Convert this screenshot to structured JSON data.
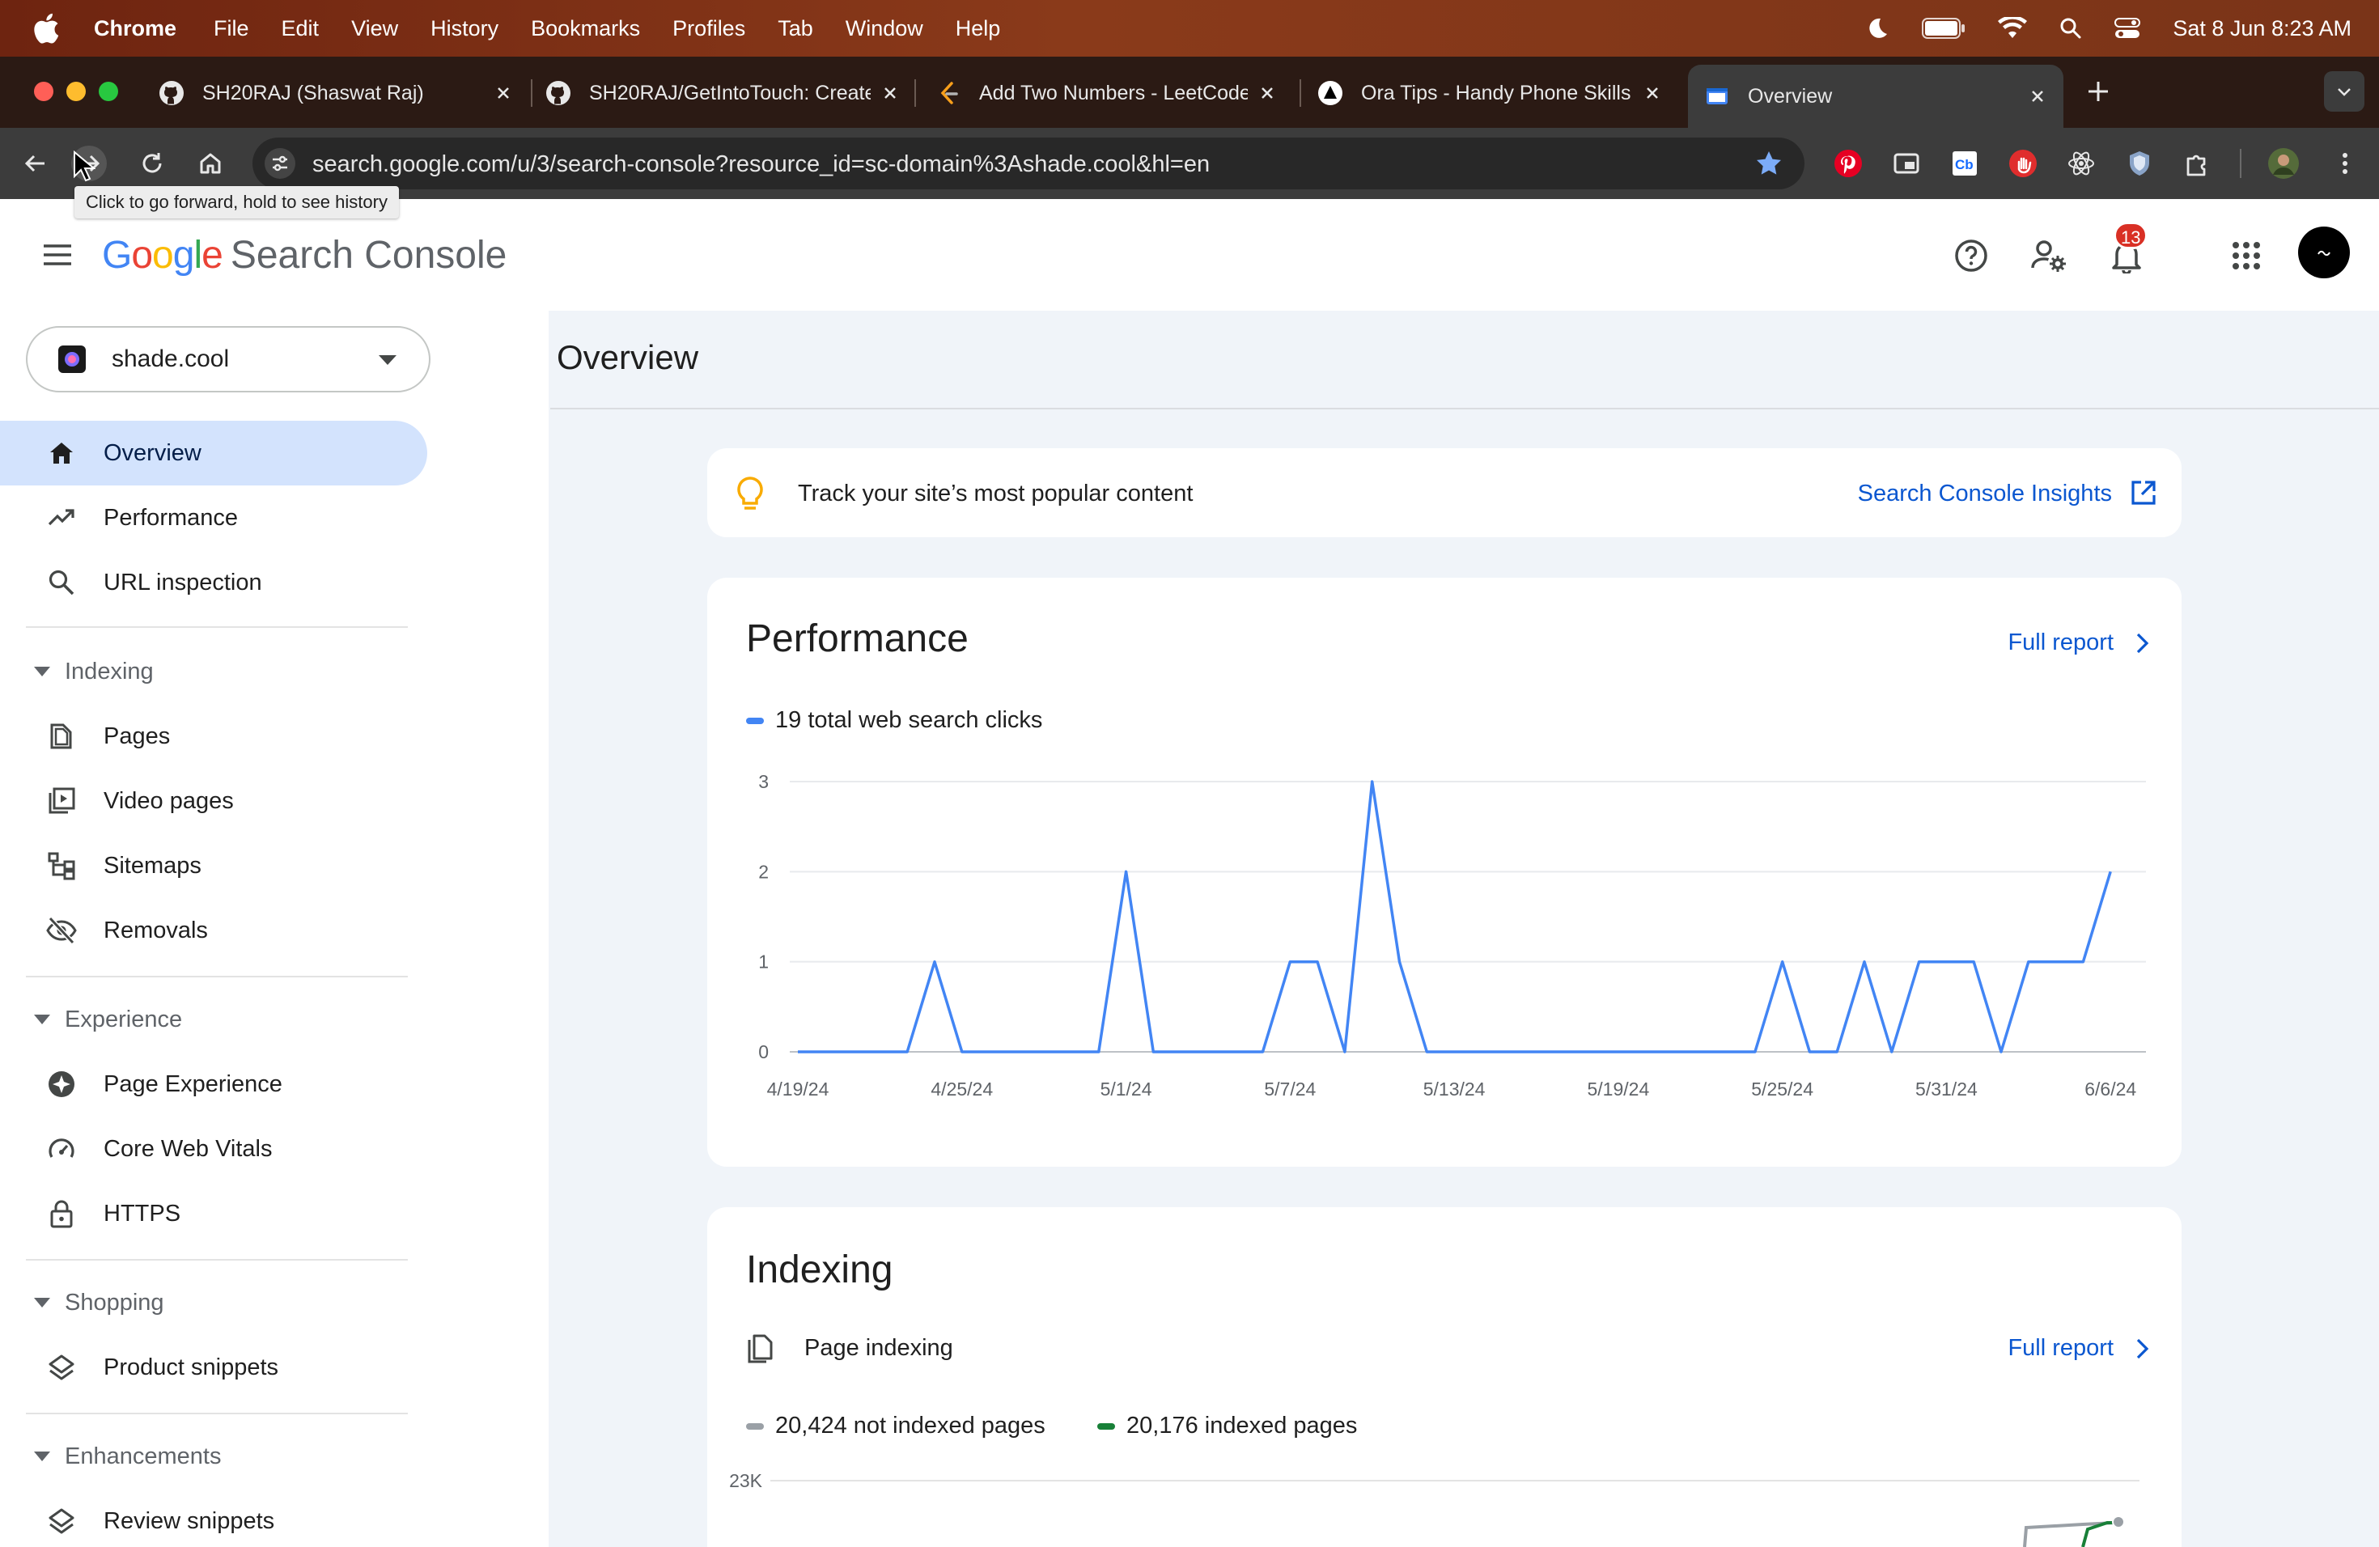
{
  "menubar": {
    "app_name": "Chrome",
    "items": [
      "File",
      "Edit",
      "View",
      "History",
      "Bookmarks",
      "Profiles",
      "Tab",
      "Window",
      "Help"
    ],
    "clock": "Sat 8 Jun  8:23 AM"
  },
  "tabs": [
    {
      "title": "SH20RAJ (Shaswat Raj)",
      "icon": "github-icon"
    },
    {
      "title": "SH20RAJ/GetIntoTouch: Create",
      "icon": "github-icon"
    },
    {
      "title": "Add Two Numbers - LeetCode",
      "icon": "leetcode-icon"
    },
    {
      "title": "Ora Tips - Handy Phone Skills",
      "icon": "ora-icon"
    },
    {
      "title": "Overview",
      "icon": "search-console-icon",
      "active": true
    }
  ],
  "toolbar": {
    "url": "search.google.com/u/3/search-console?resource_id=sc-domain%3Ashade.cool&hl=en",
    "forward_tooltip": "Click to go forward, hold to see history"
  },
  "header": {
    "logo_google": "Google",
    "logo_product": "Search Console",
    "notification_count": "13"
  },
  "sidebar": {
    "property": "shade.cool",
    "items": [
      {
        "label": "Overview",
        "icon": "home-icon",
        "selected": true
      },
      {
        "label": "Performance",
        "icon": "trending-up-icon"
      },
      {
        "label": "URL inspection",
        "icon": "search-icon"
      }
    ],
    "sections": [
      {
        "label": "Indexing",
        "items": [
          {
            "label": "Pages",
            "icon": "pages-icon"
          },
          {
            "label": "Video pages",
            "icon": "video-pages-icon"
          },
          {
            "label": "Sitemaps",
            "icon": "sitemap-icon"
          },
          {
            "label": "Removals",
            "icon": "eye-off-icon"
          }
        ]
      },
      {
        "label": "Experience",
        "items": [
          {
            "label": "Page Experience",
            "icon": "page-experience-icon"
          },
          {
            "label": "Core Web Vitals",
            "icon": "gauge-icon"
          },
          {
            "label": "HTTPS",
            "icon": "lock-icon"
          }
        ]
      },
      {
        "label": "Shopping",
        "items": [
          {
            "label": "Product snippets",
            "icon": "layers-icon"
          }
        ]
      },
      {
        "label": "Enhancements",
        "items": [
          {
            "label": "Review snippets",
            "icon": "layers-icon"
          }
        ]
      }
    ]
  },
  "main": {
    "title": "Overview",
    "insight": {
      "text": "Track your site’s most popular content",
      "link": "Search Console Insights"
    },
    "performance": {
      "title": "Performance",
      "full_report": "Full report",
      "legend": "19 total web search clicks"
    },
    "indexing": {
      "title": "Indexing",
      "subtitle": "Page indexing",
      "full_report": "Full report",
      "legend_not_indexed": "20,424 not indexed pages",
      "legend_indexed": "20,176 indexed pages",
      "y_top_label": "23K"
    }
  },
  "colors": {
    "accent_blue": "#0b57d0",
    "series_blue": "#4285f4",
    "indexed_green": "#188038",
    "not_indexed_gray": "#9aa0a6",
    "selected_nav": "#d3e3fd"
  },
  "chart_data": [
    {
      "type": "line",
      "x": [
        "4/19/24",
        "4/20/24",
        "4/21/24",
        "4/22/24",
        "4/23/24",
        "4/24/24",
        "4/25/24",
        "4/26/24",
        "4/27/24",
        "4/28/24",
        "4/29/24",
        "4/30/24",
        "5/1/24",
        "5/2/24",
        "5/3/24",
        "5/4/24",
        "5/5/24",
        "5/6/24",
        "5/7/24",
        "5/8/24",
        "5/9/24",
        "5/10/24",
        "5/11/24",
        "5/12/24",
        "5/13/24",
        "5/14/24",
        "5/15/24",
        "5/16/24",
        "5/17/24",
        "5/18/24",
        "5/19/24",
        "5/20/24",
        "5/21/24",
        "5/22/24",
        "5/23/24",
        "5/24/24",
        "5/25/24",
        "5/26/24",
        "5/27/24",
        "5/28/24",
        "5/29/24",
        "5/30/24",
        "5/31/24",
        "6/1/24",
        "6/2/24",
        "6/3/24",
        "6/4/24",
        "6/5/24",
        "6/6/24",
        "6/7/24"
      ],
      "xticks": [
        "4/19/24",
        "4/25/24",
        "5/1/24",
        "5/7/24",
        "5/13/24",
        "5/19/24",
        "5/25/24",
        "5/31/24",
        "6/6/24"
      ],
      "series": [
        {
          "name": "19 total web search clicks",
          "values": [
            0,
            0,
            0,
            0,
            0,
            1,
            0,
            0,
            0,
            0,
            0,
            0,
            2,
            0,
            0,
            0,
            0,
            0,
            1,
            1,
            0,
            3,
            1,
            0,
            0,
            0,
            0,
            0,
            0,
            0,
            0,
            0,
            0,
            0,
            0,
            0,
            1,
            0,
            0,
            1,
            0,
            1,
            1,
            1,
            0,
            1,
            1,
            1,
            2,
            null
          ]
        }
      ],
      "yticks": [
        0,
        1,
        2,
        3
      ],
      "ylim": [
        0,
        3
      ],
      "title": "Performance",
      "grid": true
    }
  ]
}
